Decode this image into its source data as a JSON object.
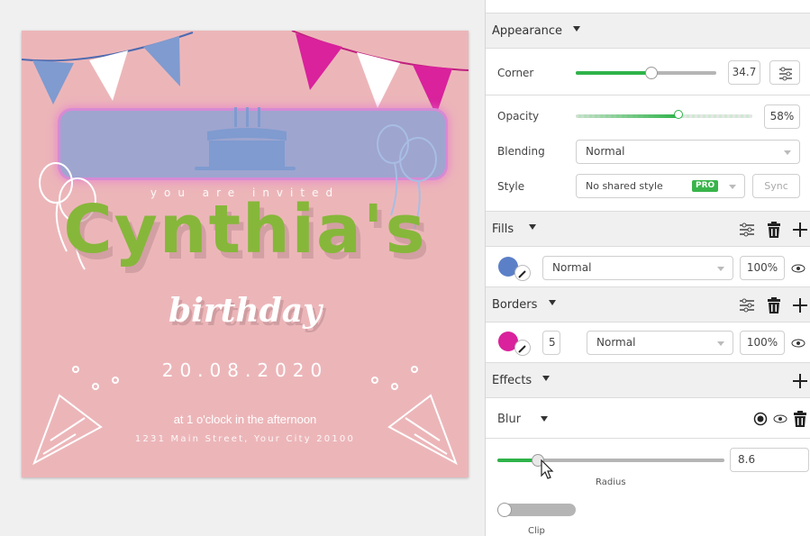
{
  "invitation": {
    "tagline": "you are invited",
    "name": "Cynthia's",
    "occasion": "birthday",
    "date": "20.08.2020",
    "time": "at 1 o'clock in the afternoon",
    "address": "1231 Main Street, Your City 20100",
    "colors": {
      "background": "#ecb6b9",
      "name": "#86b73a",
      "banner": "#9ea5cf",
      "banner_border": "#d78ad4",
      "flag_blue": "#7f9bd0",
      "flag_magenta": "#d9229c",
      "flag_white": "#ffffff"
    }
  },
  "appearance": {
    "title": "Appearance",
    "corner": {
      "label": "Corner",
      "value": "34.7",
      "fraction": 0.54
    },
    "opacity": {
      "label": "Opacity",
      "value": "58%",
      "fraction": 0.58
    },
    "blending": {
      "label": "Blending",
      "value": "Normal"
    },
    "style": {
      "label": "Style",
      "value": "No shared style",
      "badge": "PRO",
      "sync": "Sync"
    }
  },
  "fills": {
    "title": "Fills",
    "swatch_color": "#5b80c8",
    "blend": "Normal",
    "opacity": "100%"
  },
  "borders": {
    "title": "Borders",
    "swatch_color": "#d9229c",
    "width": "5",
    "blend": "Normal",
    "opacity": "100%"
  },
  "effects": {
    "title": "Effects",
    "type": "Blur",
    "radius": {
      "label": "Radius",
      "value": "8.6",
      "fraction": 0.18
    },
    "clip": {
      "label": "Clip",
      "on": false
    }
  },
  "icons": [
    "settings-sliders-icon",
    "trash-icon",
    "plus-icon",
    "eye-icon",
    "radio-icon",
    "eyedropper-icon",
    "chevron-down-icon",
    "cursor-icon"
  ]
}
